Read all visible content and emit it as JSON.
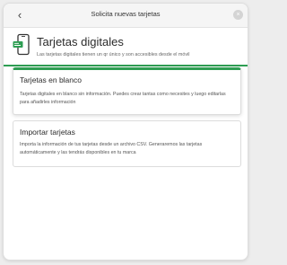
{
  "titlebar": {
    "back_glyph": "‹",
    "title": "Solicita nuevas tarjetas",
    "close_glyph": "×"
  },
  "header": {
    "icon": "phone-card-icon",
    "title": "Tarjetas digitales",
    "subtitle": "Las tarjetas digitales tienen un qr único y son accesibles desde el móvil"
  },
  "options": [
    {
      "title": "Tarjetas en blanco",
      "description": "Tarjetas digitales en blanco sin información. Puedes crear tantas como necesites y luego editarlas para añadirles información",
      "selected": true
    },
    {
      "title": "Importar tarjetas",
      "description": "Importa la información de tus tarjetas desde un archivo CSV. Generaremos las tarjetas automáticamente y las tendrás disponibles en tu marca",
      "selected": false
    }
  ],
  "colors": {
    "accent": "#2e9e53",
    "background": "#ededed",
    "panel": "#ffffff"
  }
}
